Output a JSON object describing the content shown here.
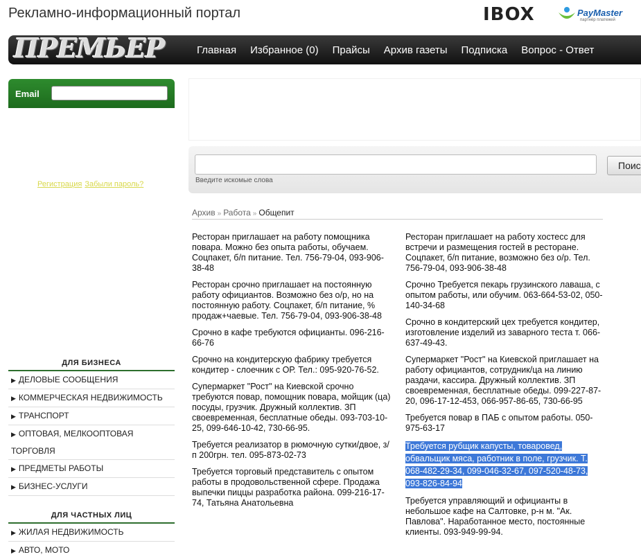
{
  "header": {
    "site_title": "Рекламно-информационный портал",
    "partner1": "IBOX",
    "partner2": "PayMaster",
    "partner2_sub": "партнёр платежей"
  },
  "nav": {
    "brand": "ПРЕМЬЕР",
    "items": [
      "Главная",
      "Избранное (0)",
      "Прайсы",
      "Архив газеты",
      "Подписка",
      "Вопрос - Ответ"
    ]
  },
  "login": {
    "email_label": "Email",
    "email_value": "",
    "register_link": "Регистрация",
    "forgot_link": "Забыли пароль?"
  },
  "business": {
    "title": "ДЛЯ БИЗНЕСА",
    "items": [
      "ДЕЛОВЫЕ СООБЩЕНИЯ",
      "КОММЕРЧЕСКАЯ НЕДВИЖИМОСТЬ",
      "ТРАНСПОРТ",
      "ОПТОВАЯ, МЕЛКООПТОВАЯ ТОРГОВЛЯ",
      "ПРЕДМЕТЫ РАБОТЫ",
      "БИЗНЕС-УСЛУГИ"
    ]
  },
  "private": {
    "title": "ДЛЯ ЧАСТНЫХ ЛИЦ",
    "items": [
      "ЖИЛАЯ НЕДВИЖИМОСТЬ",
      "АВТО, МОТО"
    ]
  },
  "search": {
    "value": "",
    "hint": "Введите искомые слова",
    "button": "Поиск"
  },
  "breadcrumb": [
    "Архив",
    "Работа",
    "Общепит"
  ],
  "ads_left": [
    "Ресторан приглашает на работу помощника повара. Можно без опыта работы, обучаем. Соцпакет, б/п питание. Тел. 756-79-04, 093-906-38-48",
    "Ресторан срочно приглашает на постоянную работу официантов. Возможно без о/р, но на постоянную работу. Соцпакет, б/п питание, % продаж+чаевые. Тел. 756-79-04, 093-906-38-48",
    "Срочно в кафе требуются официанты. 096-216-66-76",
    "Срочно на кондитерскую фабрику требуется кондитер - слоечник с ОР. Тел.: 095-920-76-52.",
    "Супермаркет \"Рост\" на Киевской срочно требуются повар, помощник повара, мойщик (ца) посуды, грузчик. Дружный коллектив. ЗП своевременная, бесплатные обеды. 093-703-10-25, 099-646-10-42, 730-66-95.",
    "Требуется реализатор в рюмочную сутки/двое, з/п 200грн. тел. 095-873-02-73",
    "Требуется торговый представитель с опытом работы в продовольственной сфере. Продажа выпечки пиццы разработка района. 099-216-17-74, Татьяна Анатольевна"
  ],
  "ads_right": [
    "Ресторан приглашает на работу хостесс для встречи и размещения гостей в ресторане. Соцпакет, б/п питание, возможно без о/р. Тел. 756-79-04, 093-906-38-48",
    "Срочно Требуется пекарь грузинского лаваша, с опытом работы, или обучим. 063-664-53-02, 050-140-34-68",
    "Срочно в кондитерский цех требуется кондитер, изготовление изделий из заварного теста т. 066-637-49-43.",
    "Супермаркет \"Рост\" на Киевской приглашает на работу официантов, сотрудник/ца на линию раздачи, кассира. Дружный коллектив. ЗП своевременная, бесплатные обеды. 099-227-87-20, 096-17-12-453, 066-957-86-65, 730-66-95",
    "Требуется повар в ПАБ с опытом работы. 050-975-63-17",
    "Требуется рубщик капусты, товаровед, обвальщик мяса, работник в поле, грузчик. Т. 068-482-29-34, 099-046-32-67, 097-520-48-73, 093-826-84-94",
    "Требуется управляющий и официанты в небольшое кафе на Салтовке, р-н м. \"Ак. Павлова\". Наработанное место, постоянные клиенты. 093-949-99-94."
  ],
  "colors": {
    "nav_bg": "#1a1a1a",
    "sidebar_green": "#2e8b2e",
    "highlight": "#3d78d8"
  }
}
